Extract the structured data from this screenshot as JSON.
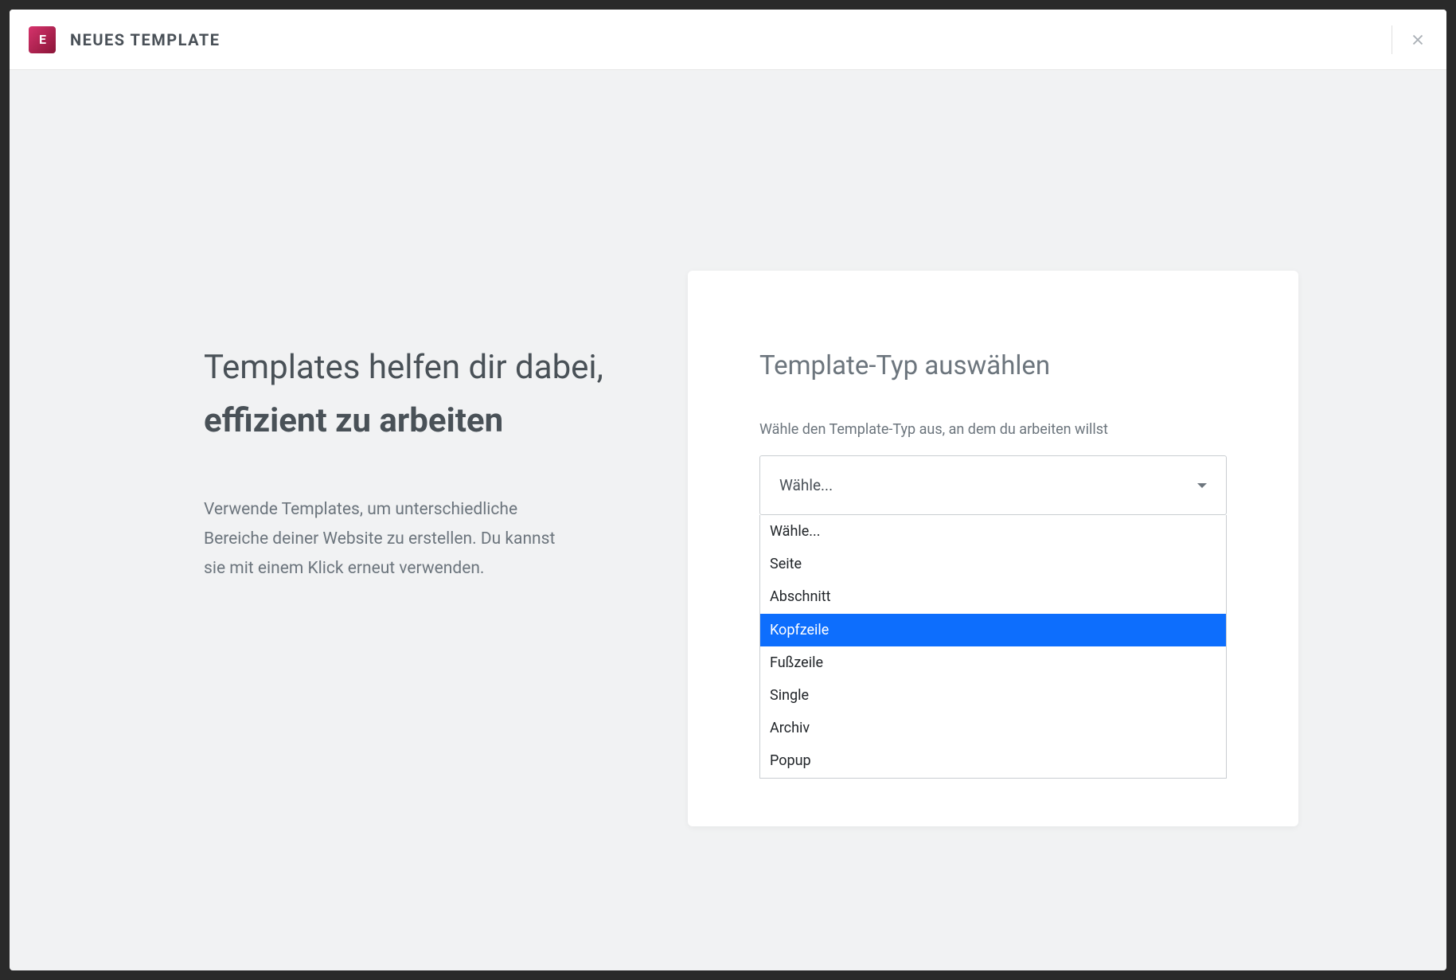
{
  "header": {
    "logo_text": "E",
    "title": "NEUES TEMPLATE"
  },
  "intro": {
    "heading_regular_1": "Templates helfen dir dabei, ",
    "heading_bold": "effizient zu arbeiten",
    "description": "Verwende Templates, um unterschiedliche Bereiche deiner Website zu erstellen. Du kannst sie mit einem Klick erneut verwenden."
  },
  "card": {
    "title": "Template-Typ auswählen",
    "field_label": "Wähle den Template-Typ aus, an dem du arbeiten willst",
    "selected_value": "Wähle...",
    "options": [
      {
        "label": "Wähle...",
        "highlighted": false
      },
      {
        "label": "Seite",
        "highlighted": false
      },
      {
        "label": "Abschnitt",
        "highlighted": false
      },
      {
        "label": "Kopfzeile",
        "highlighted": true
      },
      {
        "label": "Fußzeile",
        "highlighted": false
      },
      {
        "label": "Single",
        "highlighted": false
      },
      {
        "label": "Archiv",
        "highlighted": false
      },
      {
        "label": "Popup",
        "highlighted": false
      }
    ]
  }
}
